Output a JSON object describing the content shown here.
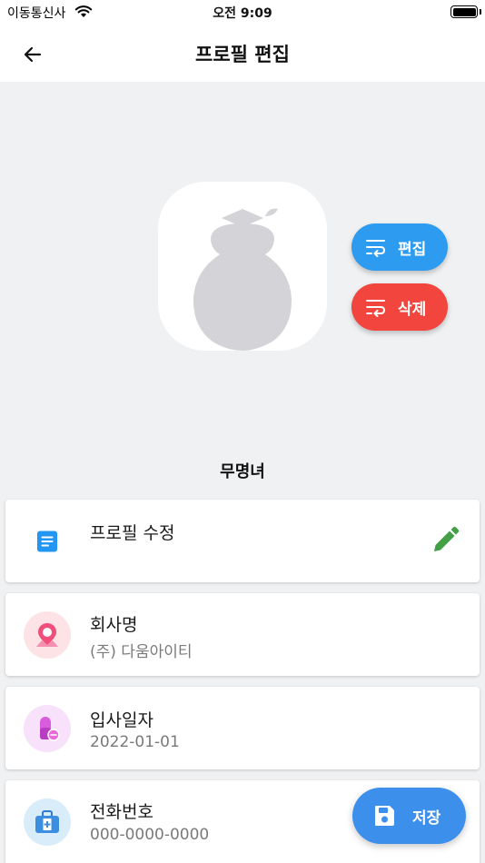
{
  "status_bar": {
    "carrier": "이동통신사",
    "time": "오전 9:09"
  },
  "header": {
    "title": "프로필 편집"
  },
  "profile": {
    "name": "무명녀",
    "edit_label": "편집",
    "delete_label": "삭제"
  },
  "cards": {
    "edit_profile": {
      "title": "프로필 수정"
    },
    "company": {
      "title": "회사명",
      "value": "(주) 다움아이티"
    },
    "join_date": {
      "title": "입사일자",
      "value": "2022-01-01"
    },
    "phone": {
      "title": "전화번호",
      "value": "000-0000-0000"
    }
  },
  "save": {
    "label": "저장"
  },
  "colors": {
    "edit_accent": "#2c9bf0",
    "delete_accent": "#f1453d",
    "save_accent": "#3d8fec",
    "pencil_green": "#43a047",
    "doc_blue": "#2196f3"
  },
  "icons": {
    "back": "arrow-left-icon",
    "wrap": "wrap-text-icon",
    "pencil": "pencil-icon",
    "document": "document-icon",
    "save": "floppy-disk-icon"
  }
}
